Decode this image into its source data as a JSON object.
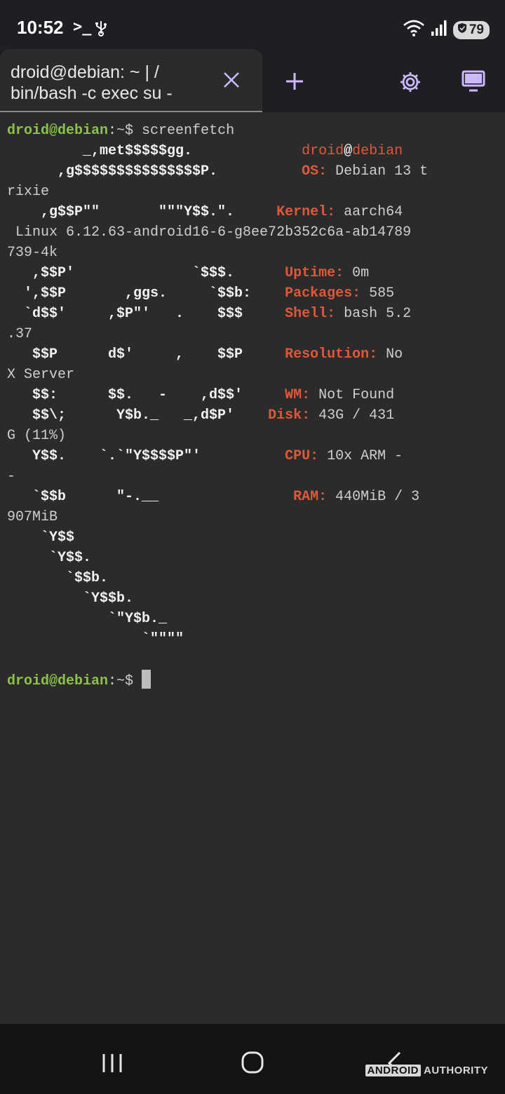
{
  "status_bar": {
    "time": "10:52",
    "terminal_glyph": ">_",
    "icons": [
      "usb-icon",
      "wifi-icon",
      "signal-icon",
      "battery-icon"
    ],
    "battery": "79"
  },
  "tab_bar": {
    "tab_title": "droid@debian: ~ | /\nbin/bash -c exec su -",
    "icons": [
      "close-icon",
      "plus-icon",
      "gear-icon",
      "monitor-icon"
    ]
  },
  "terminal": {
    "colors": {
      "prompt": "#8bc34a",
      "accent": "#e0573a",
      "text": "#cfcfcf",
      "background": "#2b2b2b"
    },
    "prompt_user": "droid@debian",
    "prompt_path": ":~$ ",
    "command": "screenfetch",
    "logo": [
      "         _,met$$$$$gg.",
      "      ,g$$$$$$$$$$$$$$$P.",
      "    ,g$$P\"\"       \"\"\"Y$$.\".",
      "   ,$$P'              `$$$.",
      "  ',$$P       ,ggs.     `$$b:",
      "  `d$$'     ,$P\"'   .    $$$",
      "   $$P      d$'     ,    $$P",
      "   $$:      $$.   -    ,d$$'",
      "   $$\\;      Y$b._   _,d$P'",
      "   Y$$.    `.`\"Y$$$$P\"'",
      "   `$$b      \"-.__",
      "    `Y$$",
      "     `Y$$.",
      "       `$$b.",
      "         `Y$$b.",
      "            `\"Y$b._",
      "                `\"\"\"\""
    ],
    "info_title": {
      "user": "droid",
      "at": "@",
      "host": "debian"
    },
    "info": [
      {
        "label": "OS:",
        "value": " Debian 13 t",
        "wrap": "rixie"
      },
      {
        "label": "Kernel:",
        "value": " aarch64",
        "wrap": " Linux 6.12.63-android16-6-g8ee72b352c6a-ab14789\n739-4k"
      },
      {
        "label": "Uptime:",
        "value": " 0m",
        "wrap": ""
      },
      {
        "label": "Packages:",
        "value": " 585",
        "wrap": ""
      },
      {
        "label": "Shell:",
        "value": " bash 5.2",
        "wrap": ".37"
      },
      {
        "label": "Resolution:",
        "value": " No",
        "wrap": "X Server"
      },
      {
        "label": "WM:",
        "value": " Not Found",
        "wrap": ""
      },
      {
        "label": "Disk:",
        "value": " 43G / 431",
        "wrap": "G (11%)"
      },
      {
        "label": "CPU:",
        "value": " 10x ARM -",
        "wrap": "-"
      },
      {
        "label": "RAM:",
        "value": " 440MiB / 3",
        "wrap": "907MiB"
      }
    ]
  },
  "nav_bar": {
    "icons": [
      "recents-icon",
      "home-icon",
      "back-icon"
    ],
    "watermark_box": "ANDROID",
    "watermark_text": "AUTHORITY"
  }
}
